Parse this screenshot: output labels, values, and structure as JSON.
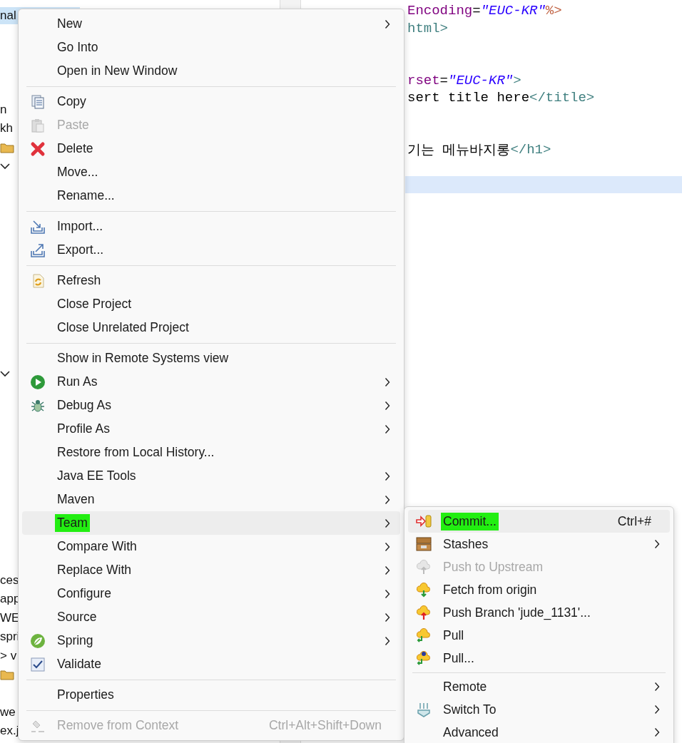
{
  "explorer": {
    "items": [
      {
        "kind": "text",
        "text": "nal",
        "selected": true
      },
      {
        "kind": "text",
        "text": "n",
        "selected": false
      },
      {
        "kind": "text",
        "text": "kh",
        "selected": false
      },
      {
        "kind": "folder",
        "selected": false
      },
      {
        "kind": "chevron",
        "selected": false
      },
      {
        "kind": "chevron",
        "selected": false
      },
      {
        "kind": "text",
        "text": "ces",
        "selected": false
      },
      {
        "kind": "text",
        "text": "app",
        "selected": false
      },
      {
        "kind": "text",
        "text": "WE",
        "selected": false
      },
      {
        "kind": "text",
        "text": "spri",
        "selected": false
      },
      {
        "kind": "text",
        "text": "> v",
        "selected": false
      },
      {
        "kind": "folder",
        "selected": false
      },
      {
        "kind": "text",
        "text": "we",
        "selected": false
      },
      {
        "kind": "text",
        "text": "ex.j",
        "selected": false
      }
    ]
  },
  "editor": {
    "lines": [
      {
        "current": false,
        "segments": [
          {
            "kind": "attr",
            "text": "Encoding"
          },
          {
            "kind": "plain",
            "text": "="
          },
          {
            "kind": "string",
            "text": "\"EUC-KR\""
          },
          {
            "kind": "directive",
            "text": "%>"
          }
        ]
      },
      {
        "current": false,
        "segments": [
          {
            "kind": "tag",
            "text": "html>"
          }
        ]
      },
      {
        "current": false
      },
      {
        "current": false
      },
      {
        "current": false,
        "segments": [
          {
            "kind": "attr",
            "text": "rset"
          },
          {
            "kind": "plain",
            "text": "="
          },
          {
            "kind": "string",
            "text": "\"EUC-KR\""
          },
          {
            "kind": "tag",
            "text": ">"
          }
        ]
      },
      {
        "current": false,
        "segments": [
          {
            "kind": "plain",
            "text": "sert title here"
          },
          {
            "kind": "tag",
            "text": "</title>"
          }
        ]
      },
      {
        "current": false
      },
      {
        "current": false
      },
      {
        "current": false,
        "segments": [
          {
            "kind": "plain",
            "text": "기는 메뉴바지롱"
          },
          {
            "kind": "tag",
            "text": "</h1>"
          }
        ]
      },
      {
        "current": false
      },
      {
        "current": true
      }
    ]
  },
  "menu": {
    "groups": [
      {
        "items": [
          {
            "label": "New",
            "submenu": true,
            "disabled": false,
            "selected": false,
            "marked": false
          },
          {
            "label": "Go Into",
            "submenu": false,
            "disabled": false,
            "selected": false,
            "marked": false
          },
          {
            "label": "Open in New Window",
            "submenu": false,
            "disabled": false,
            "selected": false,
            "marked": false
          }
        ]
      },
      {
        "items": [
          {
            "label": "Copy",
            "kind": "copy",
            "submenu": false,
            "disabled": false,
            "selected": false,
            "marked": false
          },
          {
            "label": "Paste",
            "kind": "paste",
            "submenu": false,
            "disabled": true,
            "selected": false,
            "marked": false
          },
          {
            "label": "Delete",
            "kind": "delete",
            "submenu": false,
            "disabled": false,
            "selected": false,
            "marked": false
          },
          {
            "label": "Move...",
            "submenu": false,
            "disabled": false,
            "selected": false,
            "marked": false
          },
          {
            "label": "Rename...",
            "submenu": false,
            "disabled": false,
            "selected": false,
            "marked": false
          }
        ]
      },
      {
        "items": [
          {
            "label": "Import...",
            "kind": "import",
            "submenu": false,
            "disabled": false,
            "selected": false,
            "marked": false
          },
          {
            "label": "Export...",
            "kind": "export",
            "submenu": false,
            "disabled": false,
            "selected": false,
            "marked": false
          }
        ]
      },
      {
        "items": [
          {
            "label": "Refresh",
            "kind": "refresh",
            "submenu": false,
            "disabled": false,
            "selected": false,
            "marked": false
          },
          {
            "label": "Close Project",
            "submenu": false,
            "disabled": false,
            "selected": false,
            "marked": false
          },
          {
            "label": "Close Unrelated Project",
            "submenu": false,
            "disabled": false,
            "selected": false,
            "marked": false
          }
        ]
      },
      {
        "items": [
          {
            "label": "Show in Remote Systems view",
            "submenu": false,
            "disabled": false,
            "selected": false,
            "marked": false
          },
          {
            "label": "Run As",
            "kind": "run",
            "submenu": true,
            "disabled": false,
            "selected": false,
            "marked": false
          },
          {
            "label": "Debug As",
            "kind": "debug",
            "submenu": true,
            "disabled": false,
            "selected": false,
            "marked": false
          },
          {
            "label": "Profile As",
            "submenu": true,
            "disabled": false,
            "selected": false,
            "marked": false
          },
          {
            "label": "Restore from Local History...",
            "submenu": false,
            "disabled": false,
            "selected": false,
            "marked": false
          },
          {
            "label": "Java EE Tools",
            "submenu": true,
            "disabled": false,
            "selected": false,
            "marked": false
          },
          {
            "label": "Maven",
            "submenu": true,
            "disabled": false,
            "selected": false,
            "marked": false
          },
          {
            "label": "Team",
            "submenu": true,
            "disabled": false,
            "selected": true,
            "marked": true
          },
          {
            "label": "Compare With",
            "submenu": true,
            "disabled": false,
            "selected": false,
            "marked": false
          },
          {
            "label": "Replace With",
            "submenu": true,
            "disabled": false,
            "selected": false,
            "marked": false
          },
          {
            "label": "Configure",
            "submenu": true,
            "disabled": false,
            "selected": false,
            "marked": false
          },
          {
            "label": "Source",
            "submenu": true,
            "disabled": false,
            "selected": false,
            "marked": false
          },
          {
            "label": "Spring",
            "kind": "spring",
            "submenu": true,
            "disabled": false,
            "selected": false,
            "marked": false
          },
          {
            "label": "Validate",
            "kind": "validate",
            "submenu": false,
            "disabled": false,
            "selected": false,
            "marked": false
          }
        ]
      },
      {
        "items": [
          {
            "label": "Properties",
            "submenu": false,
            "disabled": false,
            "selected": false,
            "marked": false
          }
        ]
      },
      {
        "items": [
          {
            "label": "Remove from Context",
            "kind": "remove",
            "shortcut": "Ctrl+Alt+Shift+Down",
            "submenu": false,
            "disabled": true,
            "selected": false,
            "marked": false
          }
        ]
      }
    ]
  },
  "submenu": {
    "groups": [
      {
        "items": [
          {
            "label": "Commit...",
            "kind": "commit",
            "shortcut": "Ctrl+#",
            "submenu": false,
            "disabled": false,
            "selected": true,
            "marked": true
          },
          {
            "label": "Stashes",
            "kind": "stash",
            "submenu": true,
            "disabled": false,
            "selected": false,
            "marked": false
          },
          {
            "label": "Push to Upstream",
            "kind": "upstream",
            "submenu": false,
            "disabled": true,
            "selected": false,
            "marked": false
          },
          {
            "label": "Fetch from origin",
            "kind": "fetch",
            "submenu": false,
            "disabled": false,
            "selected": false,
            "marked": false
          },
          {
            "label": "Push Branch 'jude_1131'...",
            "kind": "push",
            "submenu": false,
            "disabled": false,
            "selected": false,
            "marked": false
          },
          {
            "label": "Pull",
            "kind": "pull",
            "submenu": false,
            "disabled": false,
            "selected": false,
            "marked": false
          },
          {
            "label": "Pull...",
            "kind": "pullq",
            "submenu": false,
            "disabled": false,
            "selected": false,
            "marked": false
          }
        ]
      },
      {
        "items": [
          {
            "label": "Remote",
            "submenu": true,
            "disabled": false,
            "selected": false,
            "marked": false
          },
          {
            "label": "Switch To",
            "kind": "switch",
            "submenu": true,
            "disabled": false,
            "selected": false,
            "marked": false
          },
          {
            "label": "Advanced",
            "submenu": true,
            "disabled": false,
            "selected": false,
            "marked": false
          }
        ]
      }
    ]
  }
}
